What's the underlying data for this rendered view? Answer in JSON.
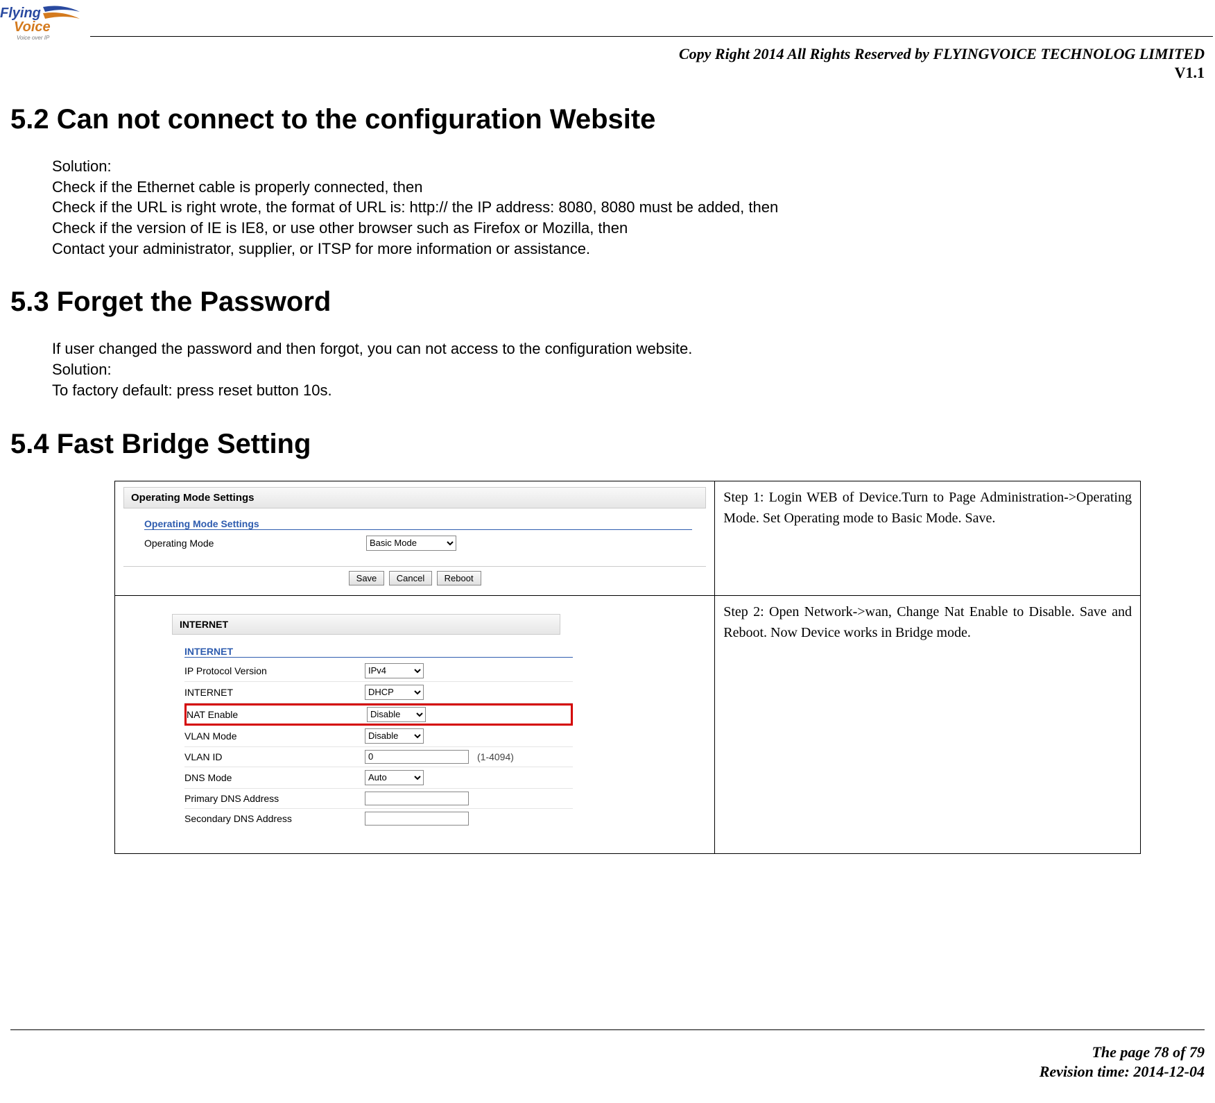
{
  "logo": {
    "brand_top": "Flying",
    "brand_bottom": "Voice",
    "tagline": "Voice over IP"
  },
  "header": {
    "copyright": "Copy Right 2014 All Rights Reserved by FLYINGVOICE TECHNOLOG LIMITED",
    "version": "V1.1"
  },
  "s52": {
    "heading": "5.2  Can not connect to the configuration Website",
    "p1": "Solution:",
    "p2": "Check if the Ethernet cable is properly connected, then",
    "p3": "Check if the URL is right wrote, the format of URL is: http:// the IP address: 8080, 8080 must be added, then",
    "p4": "Check if the version of IE is IE8, or use other browser such as Firefox or Mozilla, then",
    "p5": "Contact your administrator, supplier, or ITSP for more information or assistance."
  },
  "s53": {
    "heading": "5.3  Forget the Password",
    "p1": "If user changed the password and then forgot, you can not access to the configuration website.",
    "p2": "Solution:",
    "p3": "To factory default: press reset button 10s."
  },
  "s54": {
    "heading": "5.4  Fast Bridge Setting",
    "step1": "Step 1: Login WEB of Device.Turn to Page Administration->Operating Mode. Set Operating mode to Basic Mode. Save.",
    "step2": "Step 2: Open Network->wan, Change Nat Enable to Disable. Save and Reboot. Now Device works in Bridge mode."
  },
  "shot1": {
    "title": "Operating Mode Settings",
    "legend": "Operating Mode Settings",
    "label": "Operating Mode",
    "select_value": "Basic Mode",
    "btn_save": "Save",
    "btn_cancel": "Cancel",
    "btn_reboot": "Reboot"
  },
  "shot2": {
    "title": "INTERNET",
    "legend": "INTERNET",
    "rows": {
      "ip_proto_label": "IP Protocol Version",
      "ip_proto_val": "IPv4",
      "internet_label": "INTERNET",
      "internet_val": "DHCP",
      "nat_label": "NAT Enable",
      "nat_val": "Disable",
      "vlan_mode_label": "VLAN Mode",
      "vlan_mode_val": "Disable",
      "vlan_id_label": "VLAN ID",
      "vlan_id_val": "0",
      "vlan_id_hint": "(1-4094)",
      "dns_mode_label": "DNS Mode",
      "dns_mode_val": "Auto",
      "pdns_label": "Primary DNS Address",
      "pdns_val": "",
      "sdns_label": "Secondary DNS Address",
      "sdns_val": ""
    }
  },
  "footer": {
    "page": "The page 78 of 79",
    "rev": "Revision time: 2014-12-04"
  }
}
